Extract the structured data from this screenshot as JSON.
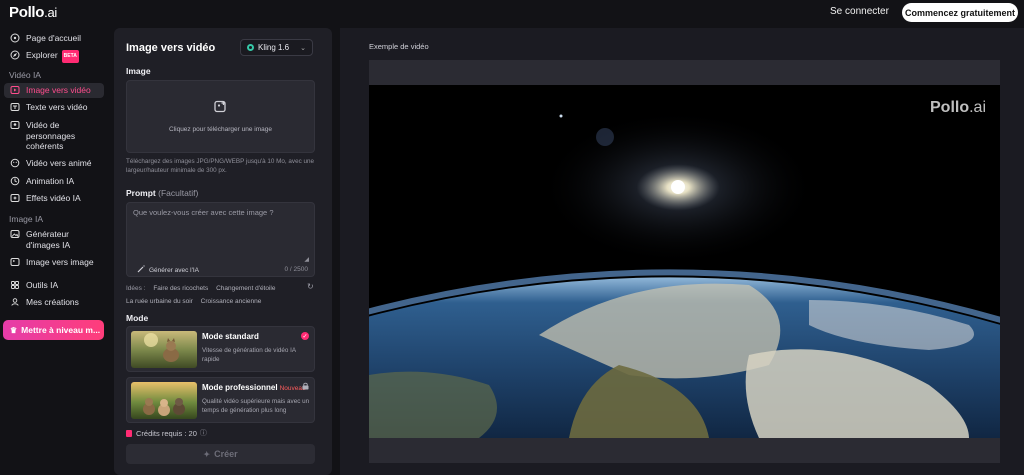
{
  "header": {
    "logo_main": "Pollo",
    "logo_suffix": ".ai",
    "signin_label": "Se connecter",
    "start_label": "Commencez gratuitement"
  },
  "sidebar": {
    "items": [
      {
        "label": "Page d'accueil",
        "icon": "home-icon"
      },
      {
        "label": "Explorer",
        "icon": "compass-icon",
        "badge": "BETA"
      }
    ],
    "section_video": "Vidéo IA",
    "video_items": [
      {
        "label": "Image vers vidéo",
        "icon": "image-video-icon",
        "active": true
      },
      {
        "label": "Texte vers vidéo",
        "icon": "text-video-icon"
      },
      {
        "label": "Vidéo de personnages cohérents",
        "icon": "character-icon"
      },
      {
        "label": "Vidéo vers animé",
        "icon": "anime-icon"
      },
      {
        "label": "Animation IA",
        "icon": "animation-icon"
      },
      {
        "label": "Effets vidéo IA",
        "icon": "effects-icon"
      }
    ],
    "section_image": "Image IA",
    "image_items": [
      {
        "label": "Générateur d'images IA",
        "icon": "image-gen-icon"
      },
      {
        "label": "Image vers image",
        "icon": "image-image-icon"
      }
    ],
    "other_items": [
      {
        "label": "Outils IA",
        "icon": "tools-icon"
      },
      {
        "label": "Mes créations",
        "icon": "creations-icon"
      }
    ],
    "upgrade_label": "Mettre à niveau m..."
  },
  "panel": {
    "title": "Image vers vidéo",
    "model": "Kling 1.6",
    "image_label": "Image",
    "upload_text": "Cliquez pour télécharger une image",
    "upload_hint": "Téléchargez des images JPG/PNG/WEBP jusqu'à 10 Mo, avec une largeur/hauteur minimale de 300 px.",
    "prompt_label": "Prompt",
    "prompt_optional": "(Facultatif)",
    "prompt_placeholder": "Que voulez-vous créer avec cette image ?",
    "generate_ai": "Générer avec l'IA",
    "counter": "0 / 2500",
    "ideas_label": "Idées :",
    "ideas": [
      "Faire des ricochets",
      "Changement d'étoile",
      "La ruée urbaine du soir",
      "Croissance ancienne"
    ],
    "mode_label": "Mode",
    "modes": [
      {
        "title": "Mode standard",
        "desc": "Vitesse de génération de vidéo IA rapide",
        "selected": true
      },
      {
        "title": "Mode professionnel",
        "badge": "Nouveau",
        "desc": "Qualité vidéo supérieure mais avec un temps de génération plus long",
        "locked": true
      }
    ],
    "credits": "Crédits requis : 20",
    "create_label": "Créer"
  },
  "main": {
    "title": "Exemple de vidéo",
    "watermark_main": "Pollo",
    "watermark_suffix": ".ai"
  },
  "colors": {
    "accent": "#ff2b73",
    "background": "#121216",
    "panel": "#1f1f26"
  }
}
